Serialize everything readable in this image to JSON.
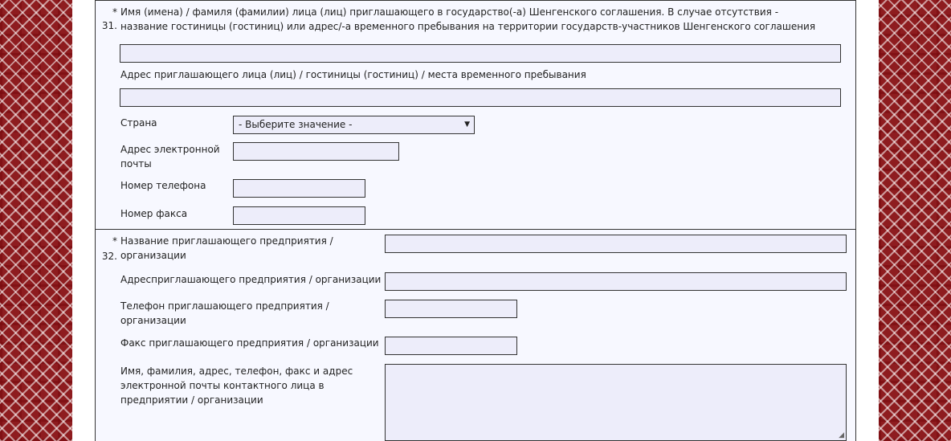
{
  "section31": {
    "star": "*",
    "number": "31.",
    "label": "Имя (имена) / фамиля (фамилии) лица (лиц) приглашающего в государство(-а) Шенгенского соглашения. В случае отсутствия - название гостиницы (гостиниц) или адрес/-а временного пребывания на территории государств-участников Шенгенского соглашения",
    "name_value": "",
    "address_label": "Адрес приглашающего лица (лиц) / гостиницы (гостиниц) / места временного пребывания",
    "address_value": "",
    "country_label": "Страна",
    "country_value": "- Выберите значение -",
    "email_label": "Адрес электронной почты",
    "email_value": "",
    "phone_label": "Номер телефона",
    "phone_value": "",
    "fax_label": "Номер факса",
    "fax_value": ""
  },
  "section32": {
    "star": "*",
    "number": "32.",
    "name_label": "Название приглашающего предприятия / организации",
    "name_value": "",
    "address_label": "Адресприглашающего предприятия / организации",
    "address_value": "",
    "phone_label": "Телефон приглашающего предприятия / организации",
    "phone_value": "",
    "fax_label": "Факс приглашающего предприятия / организации",
    "fax_value": "",
    "contact_label": "Имя, фамилия, адрес, телефон, факс и адрес электронной почты контактного лица в предприятии / организации",
    "contact_value": ""
  },
  "icons": {
    "dropdown": "triangle-down",
    "resize": "resize-grip"
  },
  "colors": {
    "ornament": "#8e1c1f",
    "field_bg": "#ededfa",
    "panel_bg": "#f7f8ff"
  }
}
